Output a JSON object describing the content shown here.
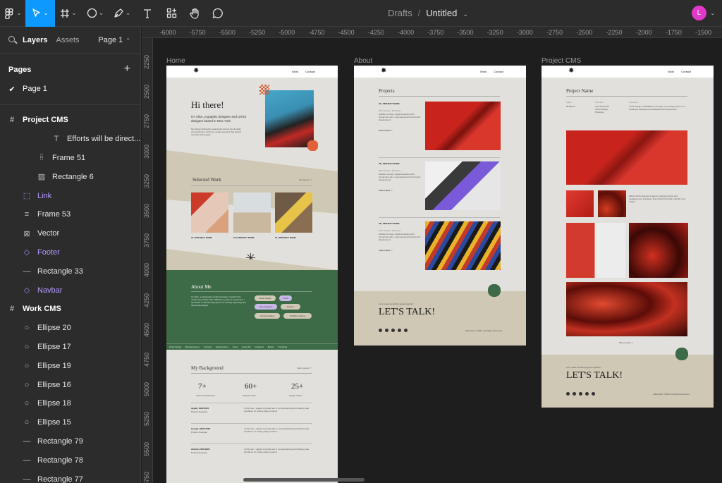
{
  "toolbar": {
    "tools": [
      "figma-menu-icon",
      "move-tool-icon",
      "frame-tool-icon",
      "shape-tool-icon",
      "pen-tool-icon",
      "text-tool-icon",
      "resources-icon",
      "hand-tool-icon",
      "comment-icon"
    ]
  },
  "file": {
    "location": "Drafts",
    "separator": "/",
    "name": "Untitled"
  },
  "user": {
    "initial": "L",
    "color": "#e339c9"
  },
  "sidebar": {
    "tab_layers": "Layers",
    "tab_assets": "Assets",
    "page_selector": "Page 1",
    "pages_title": "Pages",
    "pages": [
      {
        "label": "Page 1",
        "checked": "✔"
      }
    ],
    "layers": [
      {
        "icon": "#",
        "label": "Project CMS",
        "type": "frame",
        "indent": 0
      },
      {
        "icon": "T",
        "label": "Efforts will be direct...",
        "type": "text",
        "indent": 3
      },
      {
        "icon": "⦙⦙",
        "label": "Frame 51",
        "type": "frame",
        "indent": 2
      },
      {
        "icon": "▨",
        "label": "Rectangle 6",
        "type": "image",
        "indent": 2
      },
      {
        "icon": "⬚",
        "label": "Link",
        "type": "component",
        "indent": 1
      },
      {
        "icon": "≡",
        "label": "Frame 53",
        "type": "frame",
        "indent": 1
      },
      {
        "icon": "⊠",
        "label": "Vector",
        "type": "vector",
        "indent": 1
      },
      {
        "icon": "◇",
        "label": "Footer",
        "type": "component",
        "indent": 1
      },
      {
        "icon": "—",
        "label": "Rectangle 33",
        "type": "rect",
        "indent": 1
      },
      {
        "icon": "◇",
        "label": "Navbar",
        "type": "component",
        "indent": 1
      },
      {
        "icon": "#",
        "label": "Work CMS",
        "type": "frame",
        "indent": 0
      },
      {
        "icon": "○",
        "label": "Ellipse 20",
        "type": "ellipse",
        "indent": 1
      },
      {
        "icon": "○",
        "label": "Ellipse 17",
        "type": "ellipse",
        "indent": 1
      },
      {
        "icon": "○",
        "label": "Ellipse 19",
        "type": "ellipse",
        "indent": 1
      },
      {
        "icon": "○",
        "label": "Ellipse 16",
        "type": "ellipse",
        "indent": 1
      },
      {
        "icon": "○",
        "label": "Ellipse 18",
        "type": "ellipse",
        "indent": 1
      },
      {
        "icon": "○",
        "label": "Ellipse 15",
        "type": "ellipse",
        "indent": 1
      },
      {
        "icon": "—",
        "label": "Rectangle 79",
        "type": "rect",
        "indent": 1
      },
      {
        "icon": "—",
        "label": "Rectangle 78",
        "type": "rect",
        "indent": 1
      },
      {
        "icon": "—",
        "label": "Rectangle 77",
        "type": "rect",
        "indent": 1
      }
    ]
  },
  "rulers": {
    "h": [
      "-6000",
      "-5750",
      "-5500",
      "-5250",
      "-5000",
      "-4750",
      "-4500",
      "-4250",
      "-4000",
      "-3750",
      "-3500",
      "-3250",
      "-3000",
      "-2750",
      "-2500",
      "-2250",
      "-2000",
      "-1750",
      "-1500"
    ],
    "v": [
      "2250",
      "2500",
      "2750",
      "3000",
      "3250",
      "3500",
      "3750",
      "4000",
      "4250",
      "4500",
      "4750",
      "5000",
      "5250",
      "5500",
      "5750"
    ]
  },
  "frames": {
    "home": {
      "label": "Home",
      "nav": {
        "work": "Work",
        "contact": "Contact"
      },
      "hero_title": "Hi there!",
      "hero_sub": "I'm Alice, a graphic designer and UX/UI designer based in New York.",
      "hero_body": "My design philosophy seamlessly blends functionality and aesthetics, striving to create products that deeply resonate with people.",
      "selected_work": "Selected Work",
      "all_projects": "All projects ↗",
      "project_name": "01 | PROJECT NAME",
      "project_name2": "01 | PROJECT NAME",
      "project_name3": "01 | PROJECT NAME",
      "about_title": "About Me",
      "about_body": "I'm Alice, a passionate product designer rooted in the vibrant city of New York. With three years of experience, I specialize in transforming ideas into visually appealing and functional designs.",
      "tags": [
        "Visual design",
        "UX/UI",
        "User research",
        "Framer",
        "Communication",
        "Problem solving"
      ],
      "ticker": [
        "Product Design",
        "Brand Experience",
        "Front End",
        "Design Systems",
        "Figma",
        "Framer Pro",
        "Creative AI",
        "Blender",
        "Prototyping"
      ],
      "background_title": "My Background",
      "view_resume": "View resume ↗",
      "stats": [
        {
          "value": "7+",
          "label": "Years of Experience"
        },
        {
          "value": "60+",
          "label": "Projects Done"
        },
        {
          "value": "25+",
          "label": "Happy Clients"
        }
      ],
      "jobs": [
        {
          "title": "Apple | 2022-2024",
          "role": "Product Designer",
          "desc": "In this role, I played a pivotal part in conceptualizing and shaping user interfaces for cutting-edge products."
        },
        {
          "title": "Google | 2020-2022",
          "role": "Product Designer",
          "desc": "In this role, I played a pivotal part in conceptualizing and shaping user interfaces for cutting-edge products."
        },
        {
          "title": "Airbnb | 2016-2020",
          "role": "Product Designer",
          "desc": "In this role, I played a pivotal part in conceptualizing and shaping user interfaces for cutting-edge products."
        }
      ]
    },
    "about": {
      "label": "About",
      "nav": {
        "work": "Work",
        "contact": "Contact"
      },
      "projects_title": "Projects",
      "items": [
        {
          "name": "01 | PROJECT NAME",
          "meta": "Web Design • Branding",
          "desc": "Sudden concept, digital sculpture with human-like skin, a personal touch and brand development.",
          "link": "View project ↗"
        },
        {
          "name": "02 | PROJECT NAME",
          "meta": "Web Design • Branding",
          "desc": "Sudden concept, digital sculpture with human-like skin, a personal touch and brand development.",
          "link": "View project ↗"
        },
        {
          "name": "03 | PROJECT NAME",
          "meta": "Web Design • Branding",
          "desc": "Sudden concept, digital sculpture with human-like skin, a personal touch and brand development.",
          "link": "View project ↗"
        }
      ],
      "cta_small": "Let's make something great together!",
      "cta": "LET'S TALK!",
      "copyright": "Hilda Allen ©2024. All Rights Reserved."
    },
    "project": {
      "label": "Project CMS",
      "nav": {
        "work": "Work",
        "contact": "Contact"
      },
      "title": "Project Name",
      "meta_headers": [
        "Client",
        "Services",
        "Overview"
      ],
      "meta_values": [
        "RedBook",
        "User Research",
        "In the design of RedBook's new app, my primary focus is on creating a seamless and delightful user experience."
      ],
      "meta_values2": [
        "",
        "UX/UI Design",
        ""
      ],
      "meta_values3": [
        "",
        "Prototype",
        ""
      ],
      "body": "Efforts will be directed towards creating intuitive and engaging user interfaces that reflect the brand's identity and values.",
      "more": "More project ↗",
      "cta_small": "Let's make something great together!",
      "cta": "LET'S TALK!",
      "copyright": "Hilda Allen ©2024. All Rights Reserved."
    }
  }
}
